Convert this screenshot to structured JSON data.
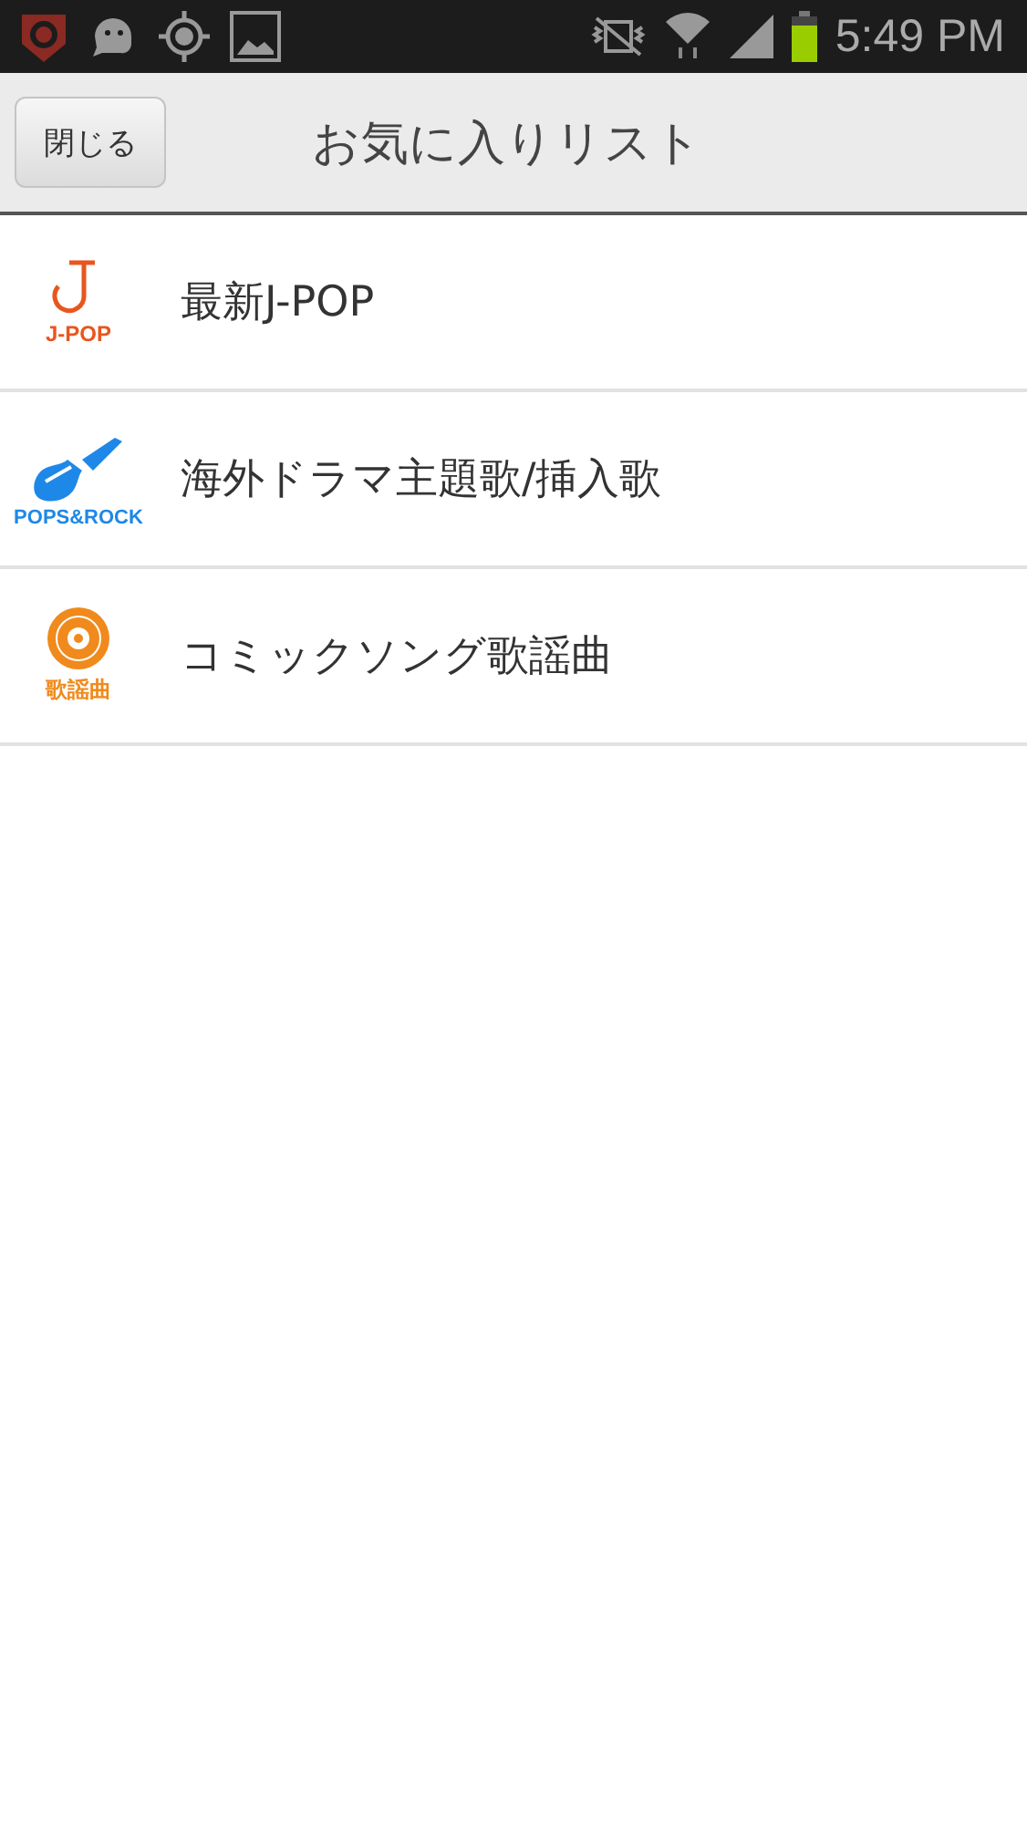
{
  "status_bar": {
    "time": "5:49 PM"
  },
  "header": {
    "close_button": "閉じる",
    "title": "お気に入りリスト"
  },
  "items": [
    {
      "kind": "note",
      "icon_label": "J-POP",
      "color": "#e8561e",
      "title": "最新J-POP"
    },
    {
      "kind": "guitar",
      "icon_label": "POPS&ROCK",
      "color": "#1e88e8",
      "title": "海外ドラマ主題歌/挿入歌"
    },
    {
      "kind": "disc",
      "icon_label": "歌謡曲",
      "color": "#f08a1c",
      "title": "コミックソング歌謡曲"
    }
  ]
}
